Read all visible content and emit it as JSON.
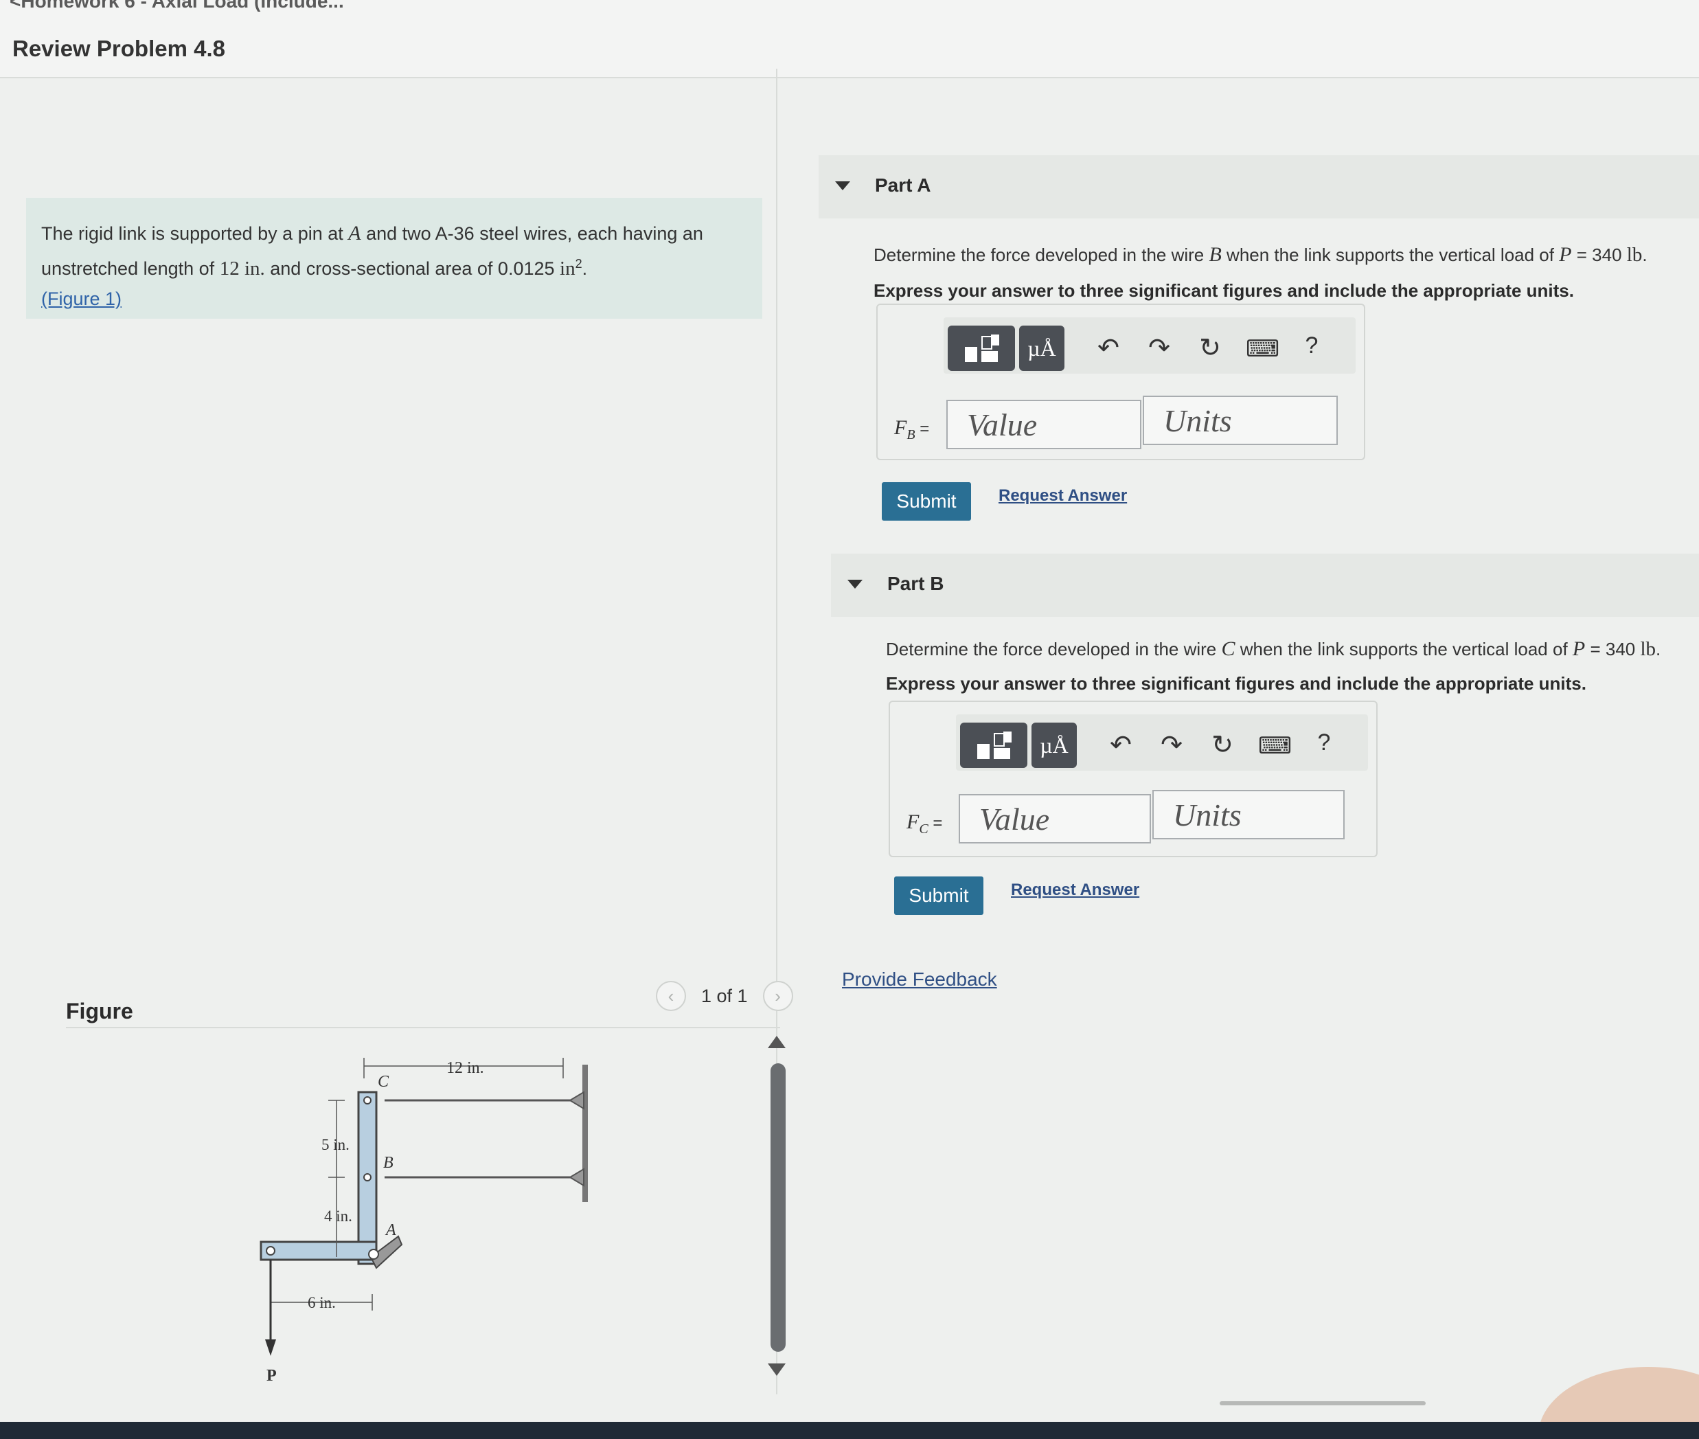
{
  "header": {
    "back_link": "<Homework 6 - Axial Load (Include...",
    "title": "Review Problem 4.8"
  },
  "problem": {
    "text_1": "The rigid link is supported by a pin at ",
    "var_a": "A",
    "text_2": " and two A-36 steel wires, each having an unstretched length of ",
    "length": "12 in.",
    "text_3": " and cross-sectional area of 0.0125 ",
    "area_unit": "in",
    "area_exp": "2",
    "text_4": ".",
    "figure_link": "(Figure 1)"
  },
  "figure": {
    "label": "Figure",
    "prev_icon": "chevron-left-icon",
    "next_icon": "chevron-right-icon",
    "page_count": "1 of 1",
    "dims": {
      "top_length": "12 in.",
      "upper_gap": "5 in.",
      "lower_gap": "4 in.",
      "arm_length": "6 in."
    },
    "points": {
      "c": "C",
      "b": "B",
      "a": "A",
      "p": "P"
    }
  },
  "part_a": {
    "title": "Part A",
    "question_1": "Determine the force developed in the wire ",
    "wire": "B",
    "question_2": " when the link supports the vertical load of ",
    "load_var": "P",
    "load_value": " = 340 ",
    "load_unit": "lb",
    "question_end": ".",
    "instruction": "Express your answer to three significant figures and include the appropriate units.",
    "label_main": "F",
    "label_sub": "B",
    "label_eq": " =",
    "value_placeholder": "Value",
    "units_placeholder": "Units",
    "submit_label": "Submit",
    "request_label": "Request Answer"
  },
  "part_b": {
    "title": "Part B",
    "question_1": "Determine the force developed in the wire ",
    "wire": "C",
    "question_2": " when the link supports the vertical load of ",
    "load_var": "P",
    "load_value": " = 340 ",
    "load_unit": "lb",
    "question_end": ".",
    "instruction": "Express your answer to three significant figures and include the appropriate units.",
    "label_main": "F",
    "label_sub": "C",
    "label_eq": " =",
    "value_placeholder": "Value",
    "units_placeholder": "Units",
    "submit_label": "Submit",
    "request_label": "Request Answer"
  },
  "toolbar": {
    "units_glyph": "µÅ",
    "undo": "↶",
    "redo": "↷",
    "reset": "↻",
    "keyboard": "⌨",
    "help": "?"
  },
  "feedback_label": "Provide Feedback",
  "colors": {
    "accent": "#2a6f94",
    "link": "#2f4f84",
    "problem_bg": "#dde9e5",
    "tool_dark": "#4b4f55"
  }
}
